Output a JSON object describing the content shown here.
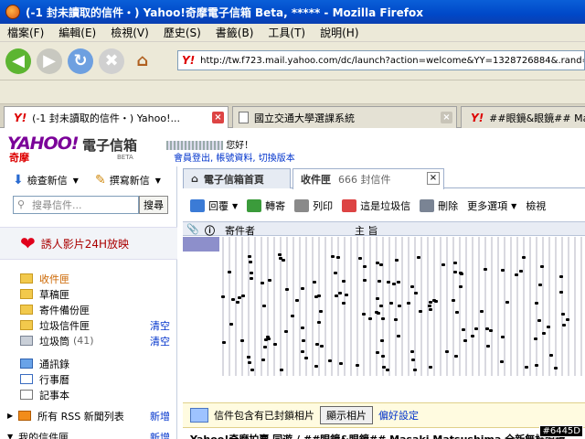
{
  "window": {
    "title": "(-1 封未讀取的信件・) Yahoo!奇摩電子信箱 Beta, ***** - Mozilla Firefox"
  },
  "menu": [
    "檔案(F)",
    "編輯(E)",
    "檢視(V)",
    "歷史(S)",
    "書籤(B)",
    "工具(T)",
    "說明(H)"
  ],
  "url": "http://tw.f723.mail.yahoo.com/dc/launch?action=welcome&YY=1328726884&.rand=e447",
  "tabs": [
    {
      "label": "(-1 封未讀取的信件・) Yahoo!..."
    },
    {
      "label": "國立交通大學選課系統"
    },
    {
      "label": "##眼鏡&眼鏡## Masa"
    }
  ],
  "header": {
    "logo": "YAHOO!",
    "logo_sub": "奇摩",
    "mail_title": "電子信箱",
    "beta": "BETA",
    "greeting": "您好！",
    "links": "會員登出, 帳號資料, 切換版本"
  },
  "left": {
    "check_mail": "檢查新信",
    "compose": "撰寫新信",
    "search_placeholder": "搜尋信件...",
    "search_button": "搜尋",
    "promo": "誘人影片24H放映",
    "folders": [
      {
        "name": "收件匣"
      },
      {
        "name": "草稿匣"
      },
      {
        "name": "寄件備份匣"
      },
      {
        "name": "垃圾信件匣",
        "action": "清空"
      },
      {
        "name": "垃圾筒",
        "count": "(41)",
        "action": "清空"
      }
    ],
    "tools": [
      {
        "name": "通訊錄"
      },
      {
        "name": "行事曆"
      },
      {
        "name": "記事本"
      }
    ],
    "rss": {
      "name": "所有 RSS 新聞列表",
      "action": "新增"
    },
    "myfolders": {
      "name": "我的信件匣",
      "action": "新增"
    }
  },
  "right": {
    "tab_home": "電子信箱首頁",
    "tab_inbox": "收件匣",
    "tab_inbox_count": "666 封信件",
    "toolbar": [
      "回覆",
      "轉寄",
      "列印",
      "這是垃圾信",
      "刪除",
      "更多選項",
      "檢視"
    ],
    "col_sender": "寄件者",
    "col_subject": "主 旨",
    "blocked_msg": "信件包含有已封鎖相片",
    "show_photos": "顯示相片",
    "settings_link": "偏好設定",
    "preview": "Yahoo!奇摩拍賣 同遊 / ##眼鏡&眼鏡## Masaki Matsushima 全新無框眼鏡"
  },
  "watermark": "#6445D",
  "colors": {
    "titlebar": "#0048c8",
    "selected_row": "#8d8fcb",
    "link": "#0033cc"
  }
}
